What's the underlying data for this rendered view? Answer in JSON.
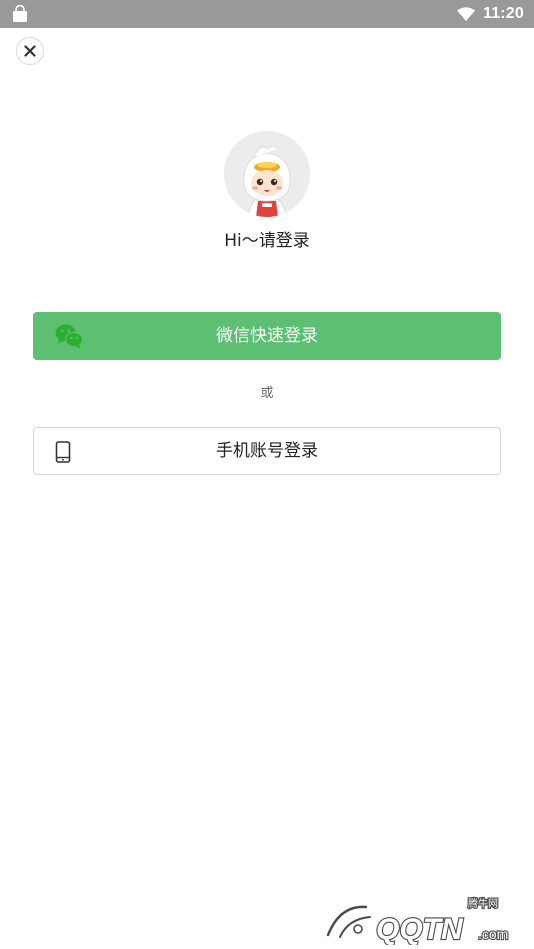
{
  "status_bar": {
    "time": "11:20",
    "left_icon": "shopping-bag-icon",
    "wifi_icon": "wifi-icon"
  },
  "close": {
    "icon": "close-icon"
  },
  "profile": {
    "avatar": "cartoon-chef-avatar",
    "greeting": "Hi～请登录"
  },
  "login": {
    "wechat_label": "微信快速登录",
    "wechat_icon": "wechat-icon",
    "or_text": "或",
    "phone_label": "手机账号登录",
    "phone_icon": "phone-icon"
  },
  "watermark": {
    "brand": "QQTN",
    "suffix": ".com",
    "tagline": "腾牛网"
  },
  "colors": {
    "status_bar": "#999999",
    "wechat_green": "#5cbf72",
    "wechat_icon_green": "#2aae2d",
    "border": "#d6d6d6"
  }
}
